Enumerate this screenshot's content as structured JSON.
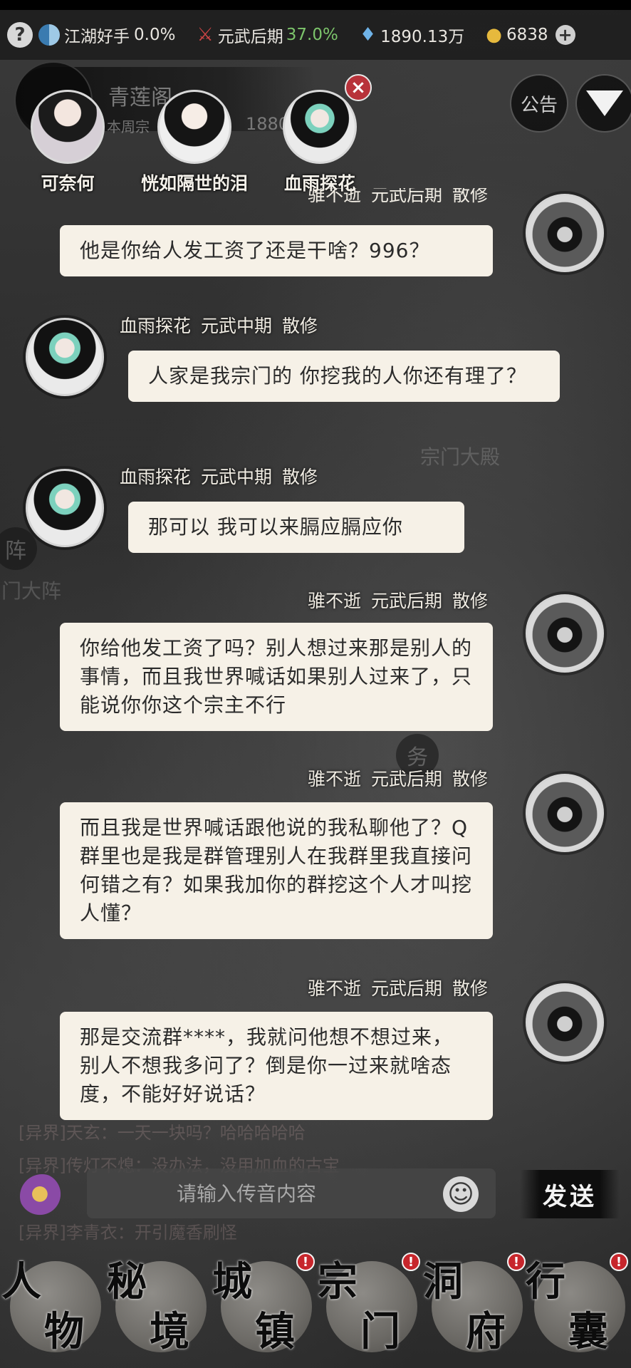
{
  "status_bar": {
    "help_icon": "?",
    "rank_label": "江湖好手",
    "rank_value": "0.0%",
    "realm_label": "元武后期",
    "realm_value": "37.0%",
    "spirit_stone": "1890.13万",
    "gold": "6838",
    "plus": "+"
  },
  "sect": {
    "name": "青莲阁",
    "sub": "本周宗",
    "num": "18806"
  },
  "buttons": {
    "announce": "公告",
    "close_x": "×",
    "send": "发送",
    "emoji": "☺"
  },
  "contacts": [
    {
      "name": "可奈何"
    },
    {
      "name": "恍如隔世的泪"
    },
    {
      "name": "血雨探花"
    }
  ],
  "messages": [
    {
      "sender": "骓不逝",
      "realm": "元武后期",
      "sect": "散修",
      "text": "他是你给人发工资了还是干啥？996？"
    },
    {
      "sender": "血雨探花",
      "realm": "元武中期",
      "sect": "散修",
      "text": "人家是我宗门的 你挖我的人你还有理了？"
    },
    {
      "sender": "血雨探花",
      "realm": "元武中期",
      "sect": "散修",
      "text": "那可以 我可以来膈应膈应你"
    },
    {
      "sender": "骓不逝",
      "realm": "元武后期",
      "sect": "散修",
      "text": "你给他发工资了吗？别人想过来那是别人的事情，而且我世界喊话如果别人过来了，只能说你你这个宗主不行"
    },
    {
      "sender": "骓不逝",
      "realm": "元武后期",
      "sect": "散修",
      "text": "而且我是世界喊话跟他说的我私聊他了？Q群里也是我是群管理别人在我群里我直接问何错之有？如果我加你的群挖这个人才叫挖人懂？"
    },
    {
      "sender": "骓不逝",
      "realm": "元武后期",
      "sect": "散修",
      "text": "那是交流群****，我就问他想不想过来，别人不想我多问了？倒是你一过来就啥态度，不能好好说话？"
    }
  ],
  "background_text": {
    "hall": "宗门大殿",
    "array1": "阵",
    "array2": "门大阵",
    "duty": "务",
    "world_line1": "[异界]天玄：一天一块吗？哈哈哈哈哈",
    "world_line2": "[异界]传灯不熄：没办法，没用加血的古宝",
    "world_line3": "[异界]李青衣：开引魔香刷怪"
  },
  "input": {
    "placeholder": "请输入传音内容"
  },
  "nav": [
    {
      "c1": "人",
      "c2": "物",
      "badge": ""
    },
    {
      "c1": "秘",
      "c2": "境",
      "badge": ""
    },
    {
      "c1": "城",
      "c2": "镇",
      "badge": "!"
    },
    {
      "c1": "宗",
      "c2": "门",
      "badge": "!"
    },
    {
      "c1": "洞",
      "c2": "府",
      "badge": "!"
    },
    {
      "c1": "行",
      "c2": "囊",
      "badge": "!"
    }
  ]
}
